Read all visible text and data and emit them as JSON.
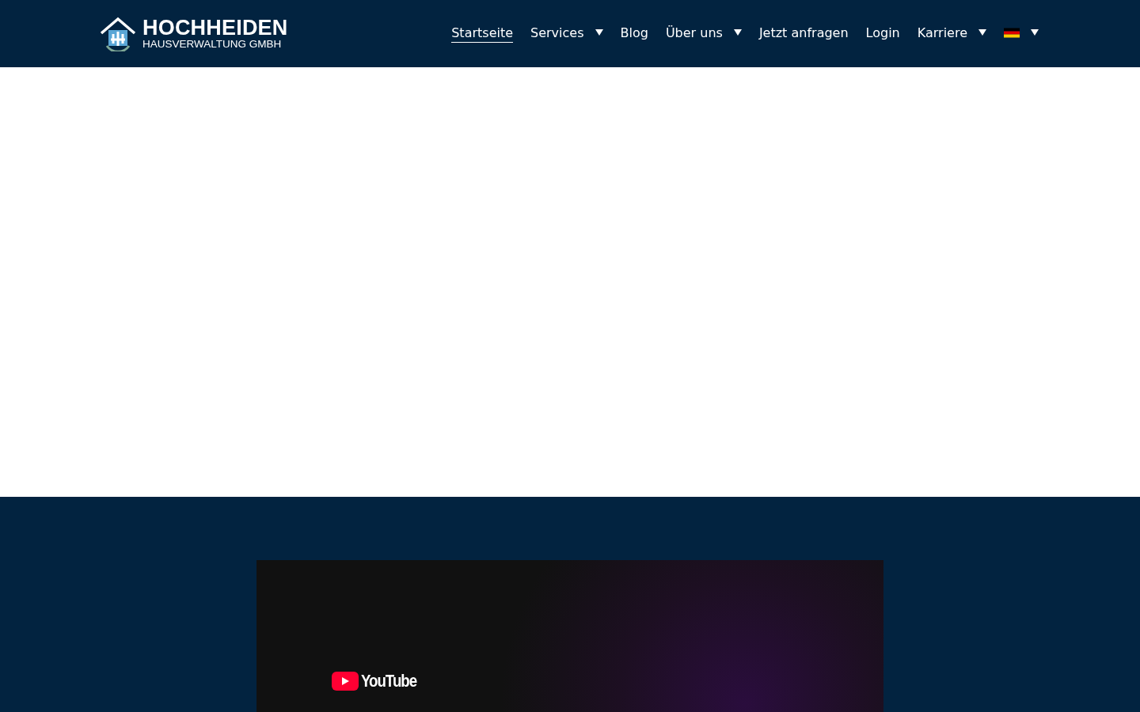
{
  "header": {
    "logo": {
      "name": "HOCHHEIDEN",
      "subtitle": "HAUSVERWALTUNG GMBH"
    },
    "nav": [
      {
        "label": "Startseite",
        "selected": true,
        "dropdown": false
      },
      {
        "label": "Services",
        "selected": false,
        "dropdown": true
      },
      {
        "label": "Blog",
        "selected": false,
        "dropdown": false
      },
      {
        "label": "Über uns",
        "selected": false,
        "dropdown": true
      },
      {
        "label": "Jetzt anfragen",
        "selected": false,
        "dropdown": false
      },
      {
        "label": "Login",
        "selected": false,
        "dropdown": false
      },
      {
        "label": "Karriere",
        "selected": false,
        "dropdown": true
      }
    ],
    "language": {
      "dropdown": true
    }
  },
  "video": {
    "brand": "YouTube"
  }
}
